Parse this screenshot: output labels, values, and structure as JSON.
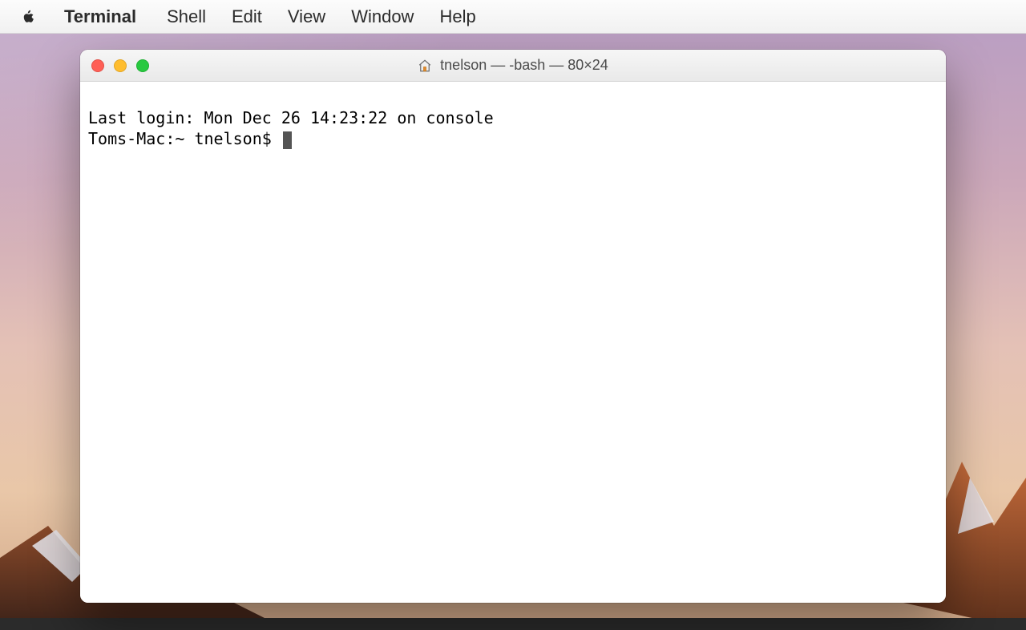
{
  "menubar": {
    "appname": "Terminal",
    "items": [
      "Shell",
      "Edit",
      "View",
      "Window",
      "Help"
    ]
  },
  "window": {
    "title": "tnelson — -bash — 80×24"
  },
  "terminal": {
    "last_login": "Last login: Mon Dec 26 14:23:22 on console",
    "prompt": "Toms-Mac:~ tnelson$ "
  }
}
